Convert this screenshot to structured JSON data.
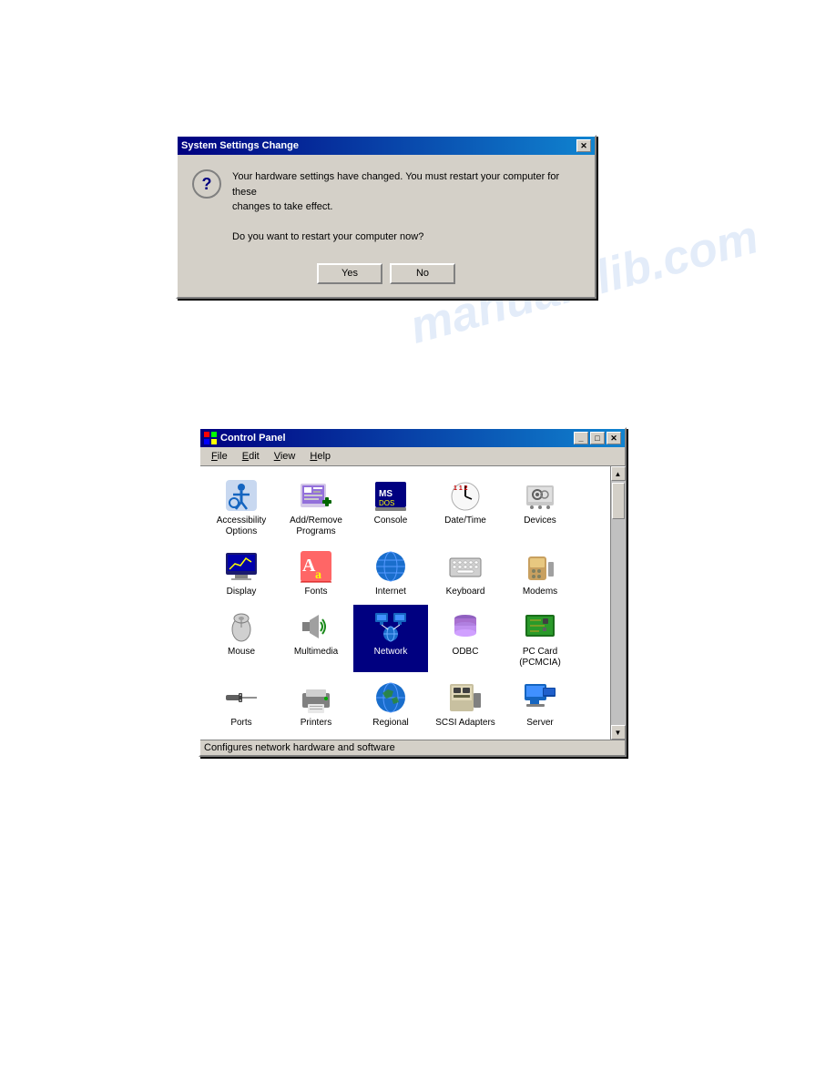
{
  "watermark": {
    "text": "manualslib.com"
  },
  "dialog": {
    "title": "System Settings Change",
    "message_line1": "Your hardware settings have changed. You must restart your computer for these",
    "message_line2": "changes to take effect.",
    "message_line3": "Do you want to restart your computer now?",
    "yes_button": "Yes",
    "no_button": "No",
    "icon": "?"
  },
  "control_panel": {
    "title": "Control Panel",
    "menu_items": [
      "File",
      "Edit",
      "View",
      "Help"
    ],
    "statusbar": "Configures network hardware and software",
    "titlebar_buttons": [
      "_",
      "□",
      "✕"
    ],
    "icons": [
      {
        "id": "accessibility",
        "label": "Accessibility\nOptions",
        "emoji": "♿"
      },
      {
        "id": "addremove",
        "label": "Add/Remove\nPrograms",
        "emoji": "📦"
      },
      {
        "id": "console",
        "label": "Console",
        "emoji": "💻"
      },
      {
        "id": "datetime",
        "label": "Date/Time",
        "emoji": "🕐"
      },
      {
        "id": "devices",
        "label": "Devices",
        "emoji": "⚙️"
      },
      {
        "id": "display",
        "label": "Display",
        "emoji": "🖥️"
      },
      {
        "id": "fonts",
        "label": "Fonts",
        "emoji": "🔤"
      },
      {
        "id": "internet",
        "label": "Internet",
        "emoji": "🌐"
      },
      {
        "id": "keyboard",
        "label": "Keyboard",
        "emoji": "⌨️"
      },
      {
        "id": "modems",
        "label": "Modems",
        "emoji": "📠"
      },
      {
        "id": "mouse",
        "label": "Mouse",
        "emoji": "🖱️"
      },
      {
        "id": "multimedia",
        "label": "Multimedia",
        "emoji": "🎵"
      },
      {
        "id": "network",
        "label": "Network",
        "emoji": "🌐",
        "selected": true
      },
      {
        "id": "odbc",
        "label": "ODBC",
        "emoji": "🗄️"
      },
      {
        "id": "pccard",
        "label": "PC Card\n(PCMCIA)",
        "emoji": "💳"
      },
      {
        "id": "ports",
        "label": "Ports",
        "emoji": "🔌"
      },
      {
        "id": "printers",
        "label": "Printers",
        "emoji": "🖨️"
      },
      {
        "id": "regional",
        "label": "Regional",
        "emoji": "🌍"
      },
      {
        "id": "scsi",
        "label": "SCSI Adapters",
        "emoji": "🔧"
      },
      {
        "id": "server",
        "label": "Server",
        "emoji": "🖥️"
      }
    ]
  }
}
